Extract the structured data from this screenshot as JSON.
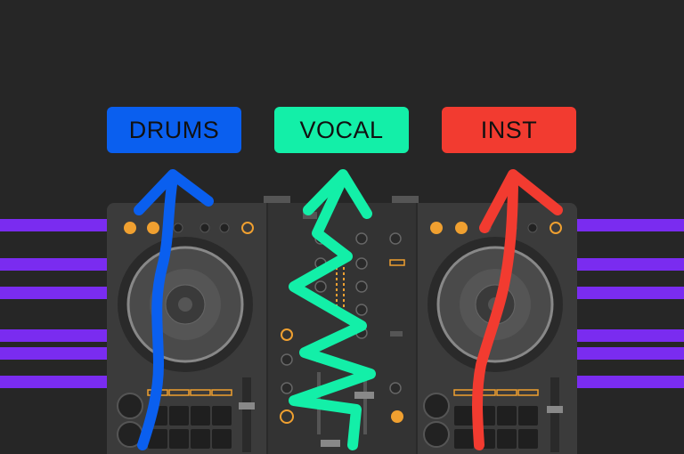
{
  "labels": {
    "drums": "DRUMS",
    "vocal": "VOCAL",
    "inst": "INST"
  },
  "colors": {
    "background": "#262626",
    "drums": "#0a5fef",
    "vocal": "#13efa8",
    "inst": "#f23b30",
    "stripes": "#7a2cf0",
    "controller_body": "#3a3a3a",
    "knob_accent": "#f0a030"
  },
  "icons": [
    "arrow-up-drums-icon",
    "arrow-up-vocal-icon",
    "arrow-up-inst-icon",
    "jog-wheel-icon"
  ]
}
